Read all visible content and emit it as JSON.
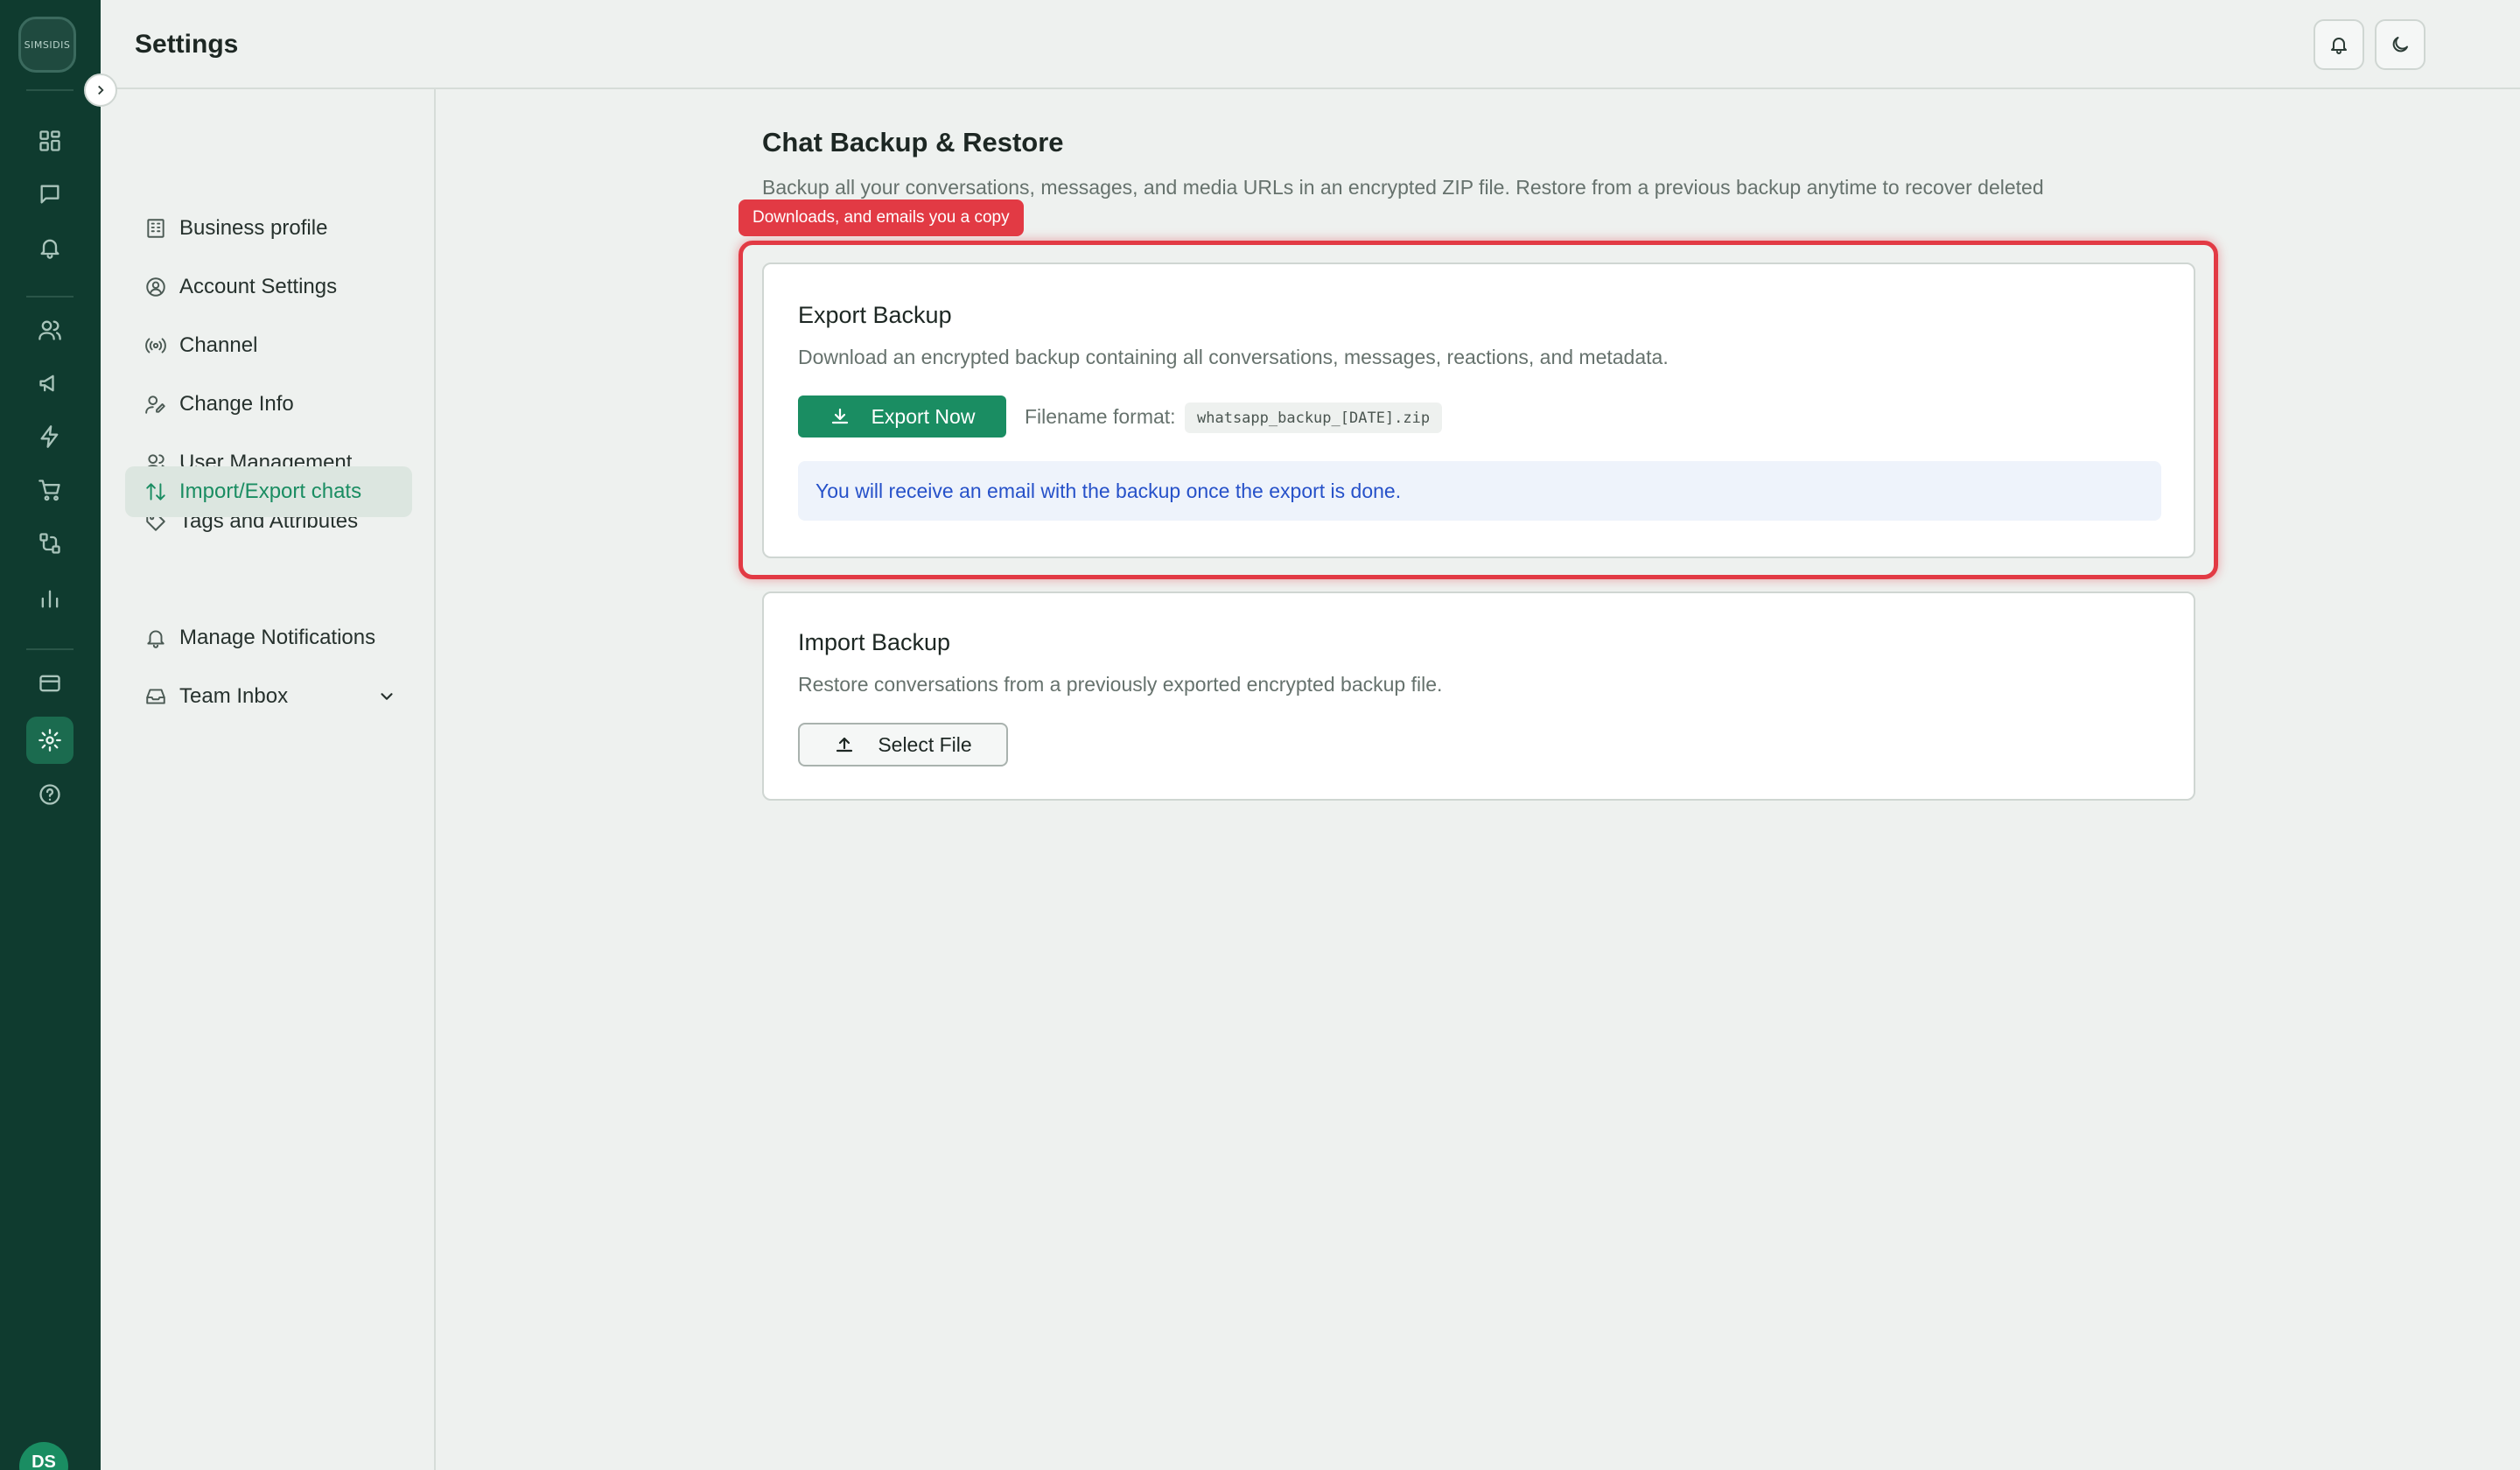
{
  "app": {
    "logo_text": "SIMSIDIS",
    "user_initials": "DS"
  },
  "header": {
    "title": "Settings"
  },
  "rail": {
    "items": [
      {
        "name": "dashboard-icon",
        "active": false
      },
      {
        "name": "chat-icon",
        "active": false
      },
      {
        "name": "bell-icon",
        "active": false
      },
      {
        "name": "contacts-icon",
        "active": false
      },
      {
        "name": "megaphone-icon",
        "active": false
      },
      {
        "name": "lightning-icon",
        "active": false
      },
      {
        "name": "cart-icon",
        "active": false
      },
      {
        "name": "flow-icon",
        "active": false
      },
      {
        "name": "analytics-icon",
        "active": false
      },
      {
        "name": "billing-icon",
        "active": false
      },
      {
        "name": "settings-gear-icon",
        "active": true
      },
      {
        "name": "help-icon",
        "active": false
      }
    ]
  },
  "sidebar": {
    "items": [
      {
        "label": "Business profile",
        "icon": "building-icon"
      },
      {
        "label": "Account Settings",
        "icon": "user-circle-icon"
      },
      {
        "label": "Channel",
        "icon": "broadcast-icon"
      },
      {
        "label": "Change Info",
        "icon": "user-edit-icon"
      },
      {
        "label": "User Management",
        "icon": "users-icon"
      },
      {
        "label": "Tags and Attributes",
        "icon": "tag-icon"
      },
      {
        "label": "Import/Export chats",
        "icon": "arrows-up-down-icon",
        "active": true
      },
      {
        "label": "Manage Notifications",
        "icon": "bell-icon"
      },
      {
        "label": "Team Inbox",
        "icon": "inbox-icon",
        "has_chevron": true
      }
    ]
  },
  "main": {
    "title": "Chat Backup & Restore",
    "description": "Backup all your conversations, messages, and media URLs in an encrypted ZIP file. Restore from a previous backup anytime to recover deleted",
    "highlight_tag": "Downloads, and emails you a copy",
    "highlight_color": "#e23a44",
    "accent_color": "#1a8d62",
    "export": {
      "title": "Export Backup",
      "description": "Download an encrypted backup containing all conversations, messages, reactions, and metadata.",
      "button_label": "Export Now",
      "filename_label": "Filename format:",
      "filename_value": "whatsapp_backup_[DATE].zip",
      "notice": "You will receive an email with the backup once the export is done."
    },
    "import": {
      "title": "Import Backup",
      "description": "Restore conversations from a previously exported encrypted backup file.",
      "button_label": "Select File"
    }
  }
}
